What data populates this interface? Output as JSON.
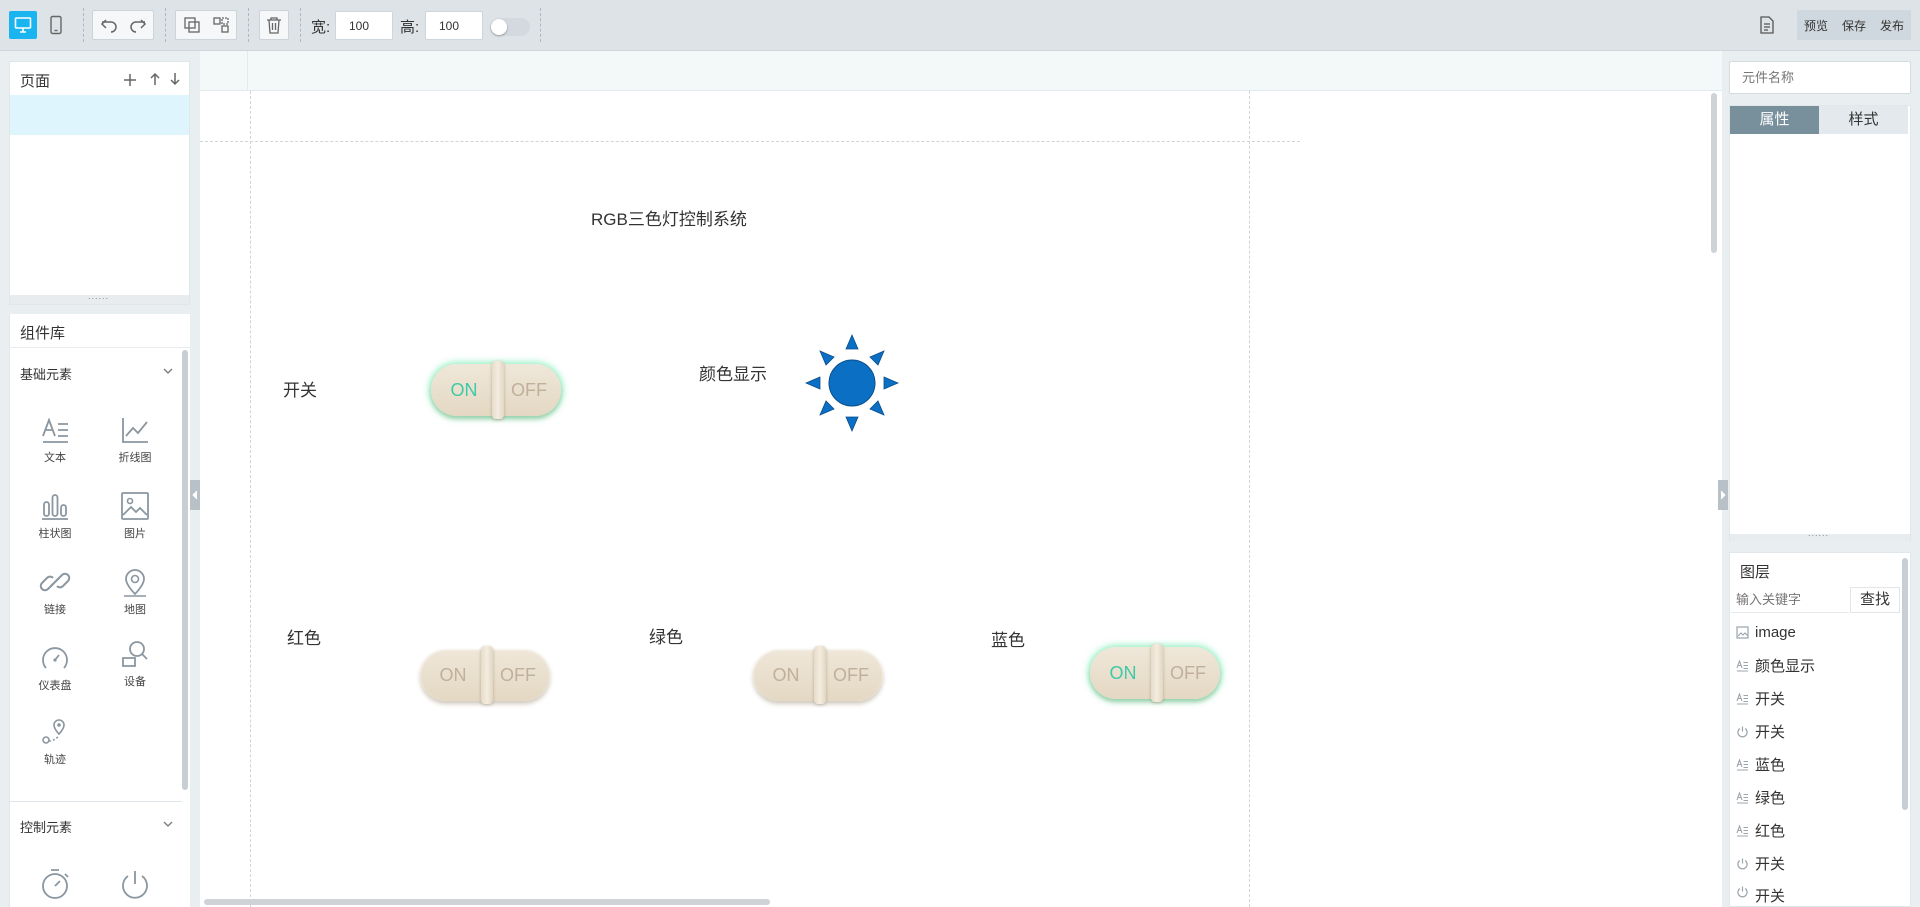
{
  "toolbar": {
    "width_label": "宽:",
    "width_value": "100",
    "height_label": "高:",
    "height_value": "100",
    "preview": "预览",
    "save": "保存",
    "publish": "发布"
  },
  "pages_panel": {
    "title": "页面"
  },
  "library": {
    "title": "组件库",
    "basic_category": "基础元素",
    "basic_items": [
      "文本",
      "折线图",
      "柱状图",
      "图片",
      "链接",
      "地图",
      "仪表盘",
      "设备",
      "轨迹"
    ],
    "control_category": "控制元素"
  },
  "canvas": {
    "title": "RGB三色灯控制系统",
    "switch_label": "开关",
    "color_display_label": "颜色显示",
    "red_label": "红色",
    "green_label": "绿色",
    "blue_label": "蓝色",
    "on_text": "ON",
    "off_text": "OFF",
    "sun_color": "#0b6fc4",
    "on_glow_color": "#40e696",
    "toggles": {
      "switch": "on",
      "red": "off",
      "green": "off",
      "blue": "on"
    }
  },
  "properties": {
    "name_placeholder": "元件名称",
    "tab_attributes": "属性",
    "tab_style": "样式"
  },
  "layers": {
    "title": "图层",
    "search_placeholder": "输入关键字",
    "search_button": "查找",
    "items": [
      {
        "icon": "image-icon",
        "label": "image"
      },
      {
        "icon": "text-icon",
        "label": "颜色显示"
      },
      {
        "icon": "text-icon",
        "label": "开关"
      },
      {
        "icon": "power-icon",
        "label": "开关"
      },
      {
        "icon": "text-icon",
        "label": "蓝色"
      },
      {
        "icon": "text-icon",
        "label": "绿色"
      },
      {
        "icon": "text-icon",
        "label": "红色"
      },
      {
        "icon": "power-icon",
        "label": "开关"
      },
      {
        "icon": "power-icon",
        "label": "开关"
      }
    ]
  },
  "colors": {
    "accent": "#1ab5f0",
    "active_tab": "#78909c",
    "inactive_tab": "#e3e9ec"
  }
}
